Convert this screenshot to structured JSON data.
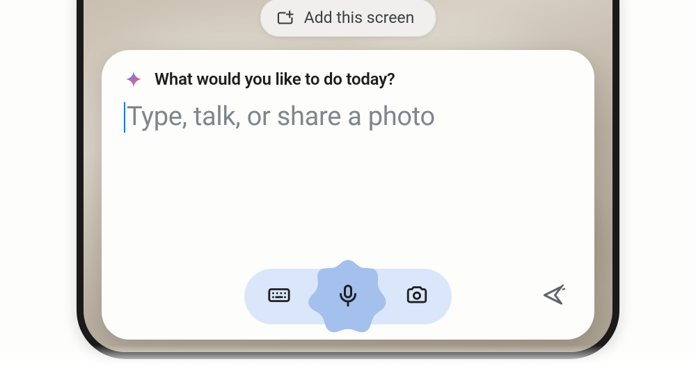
{
  "chip": {
    "label": "Add this screen"
  },
  "card": {
    "prompt": "What would you like to do today?",
    "placeholder": "Type, talk, or share a photo"
  }
}
